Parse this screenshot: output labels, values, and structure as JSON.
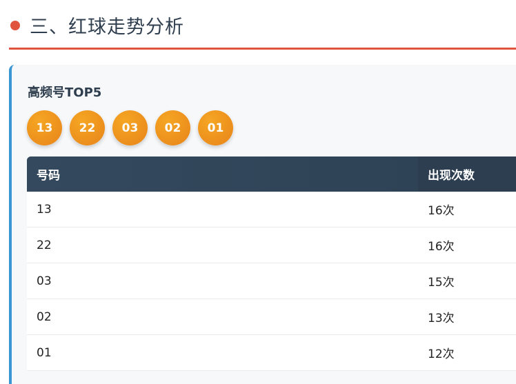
{
  "section": {
    "title": "三、红球走势分析"
  },
  "card": {
    "title": "高频号TOP5",
    "balls": [
      "13",
      "22",
      "03",
      "02",
      "01"
    ]
  },
  "table": {
    "headers": [
      "号码",
      "出现次数"
    ],
    "rows": [
      [
        "13",
        "16次"
      ],
      [
        "22",
        "16次"
      ],
      [
        "03",
        "15次"
      ],
      [
        "02",
        "13次"
      ],
      [
        "01",
        "12次"
      ]
    ]
  },
  "colors": {
    "accent_red": "#e0533d",
    "accent_blue": "#3b97d3",
    "ball_orange": "#f39c12",
    "header_dark": "#34495e"
  }
}
